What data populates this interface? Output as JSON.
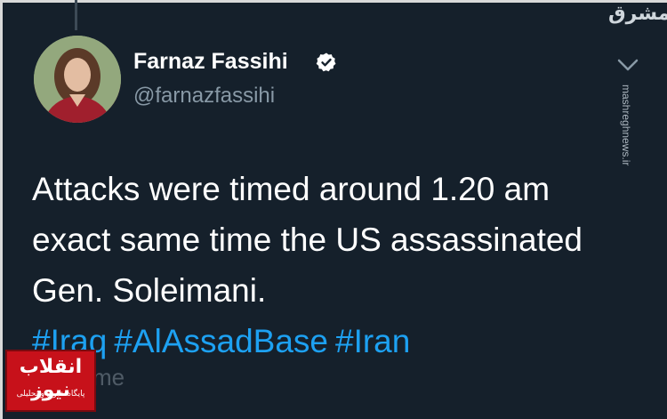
{
  "profile": {
    "display_name": "Farnaz Fassihi",
    "handle": "@farnazfassihi"
  },
  "tweet": {
    "text": "Attacks were timed around 1.20 am exact same time the US assassinated Gen. Soleimani.",
    "hashtags": [
      "#Iraq",
      "#AlAssadBase",
      "#Iran"
    ]
  },
  "ghost_overlay_text": "me",
  "watermarks": {
    "top_right_logo": "مشرق",
    "side_site": "mashreghnews.ir",
    "bottom_left_name": "انقلاب نیوز",
    "bottom_left_tagline": "پایگاه خبری و تحلیلی"
  },
  "colors": {
    "background": "#15202b",
    "text": "#ffffff",
    "secondary": "#8899a6",
    "hashtag": "#1da1f2",
    "verified": "#ffffff",
    "news_logo": "#c7111a"
  },
  "icons": {
    "verified": "verified-badge-icon",
    "more": "chevron-down-icon"
  }
}
